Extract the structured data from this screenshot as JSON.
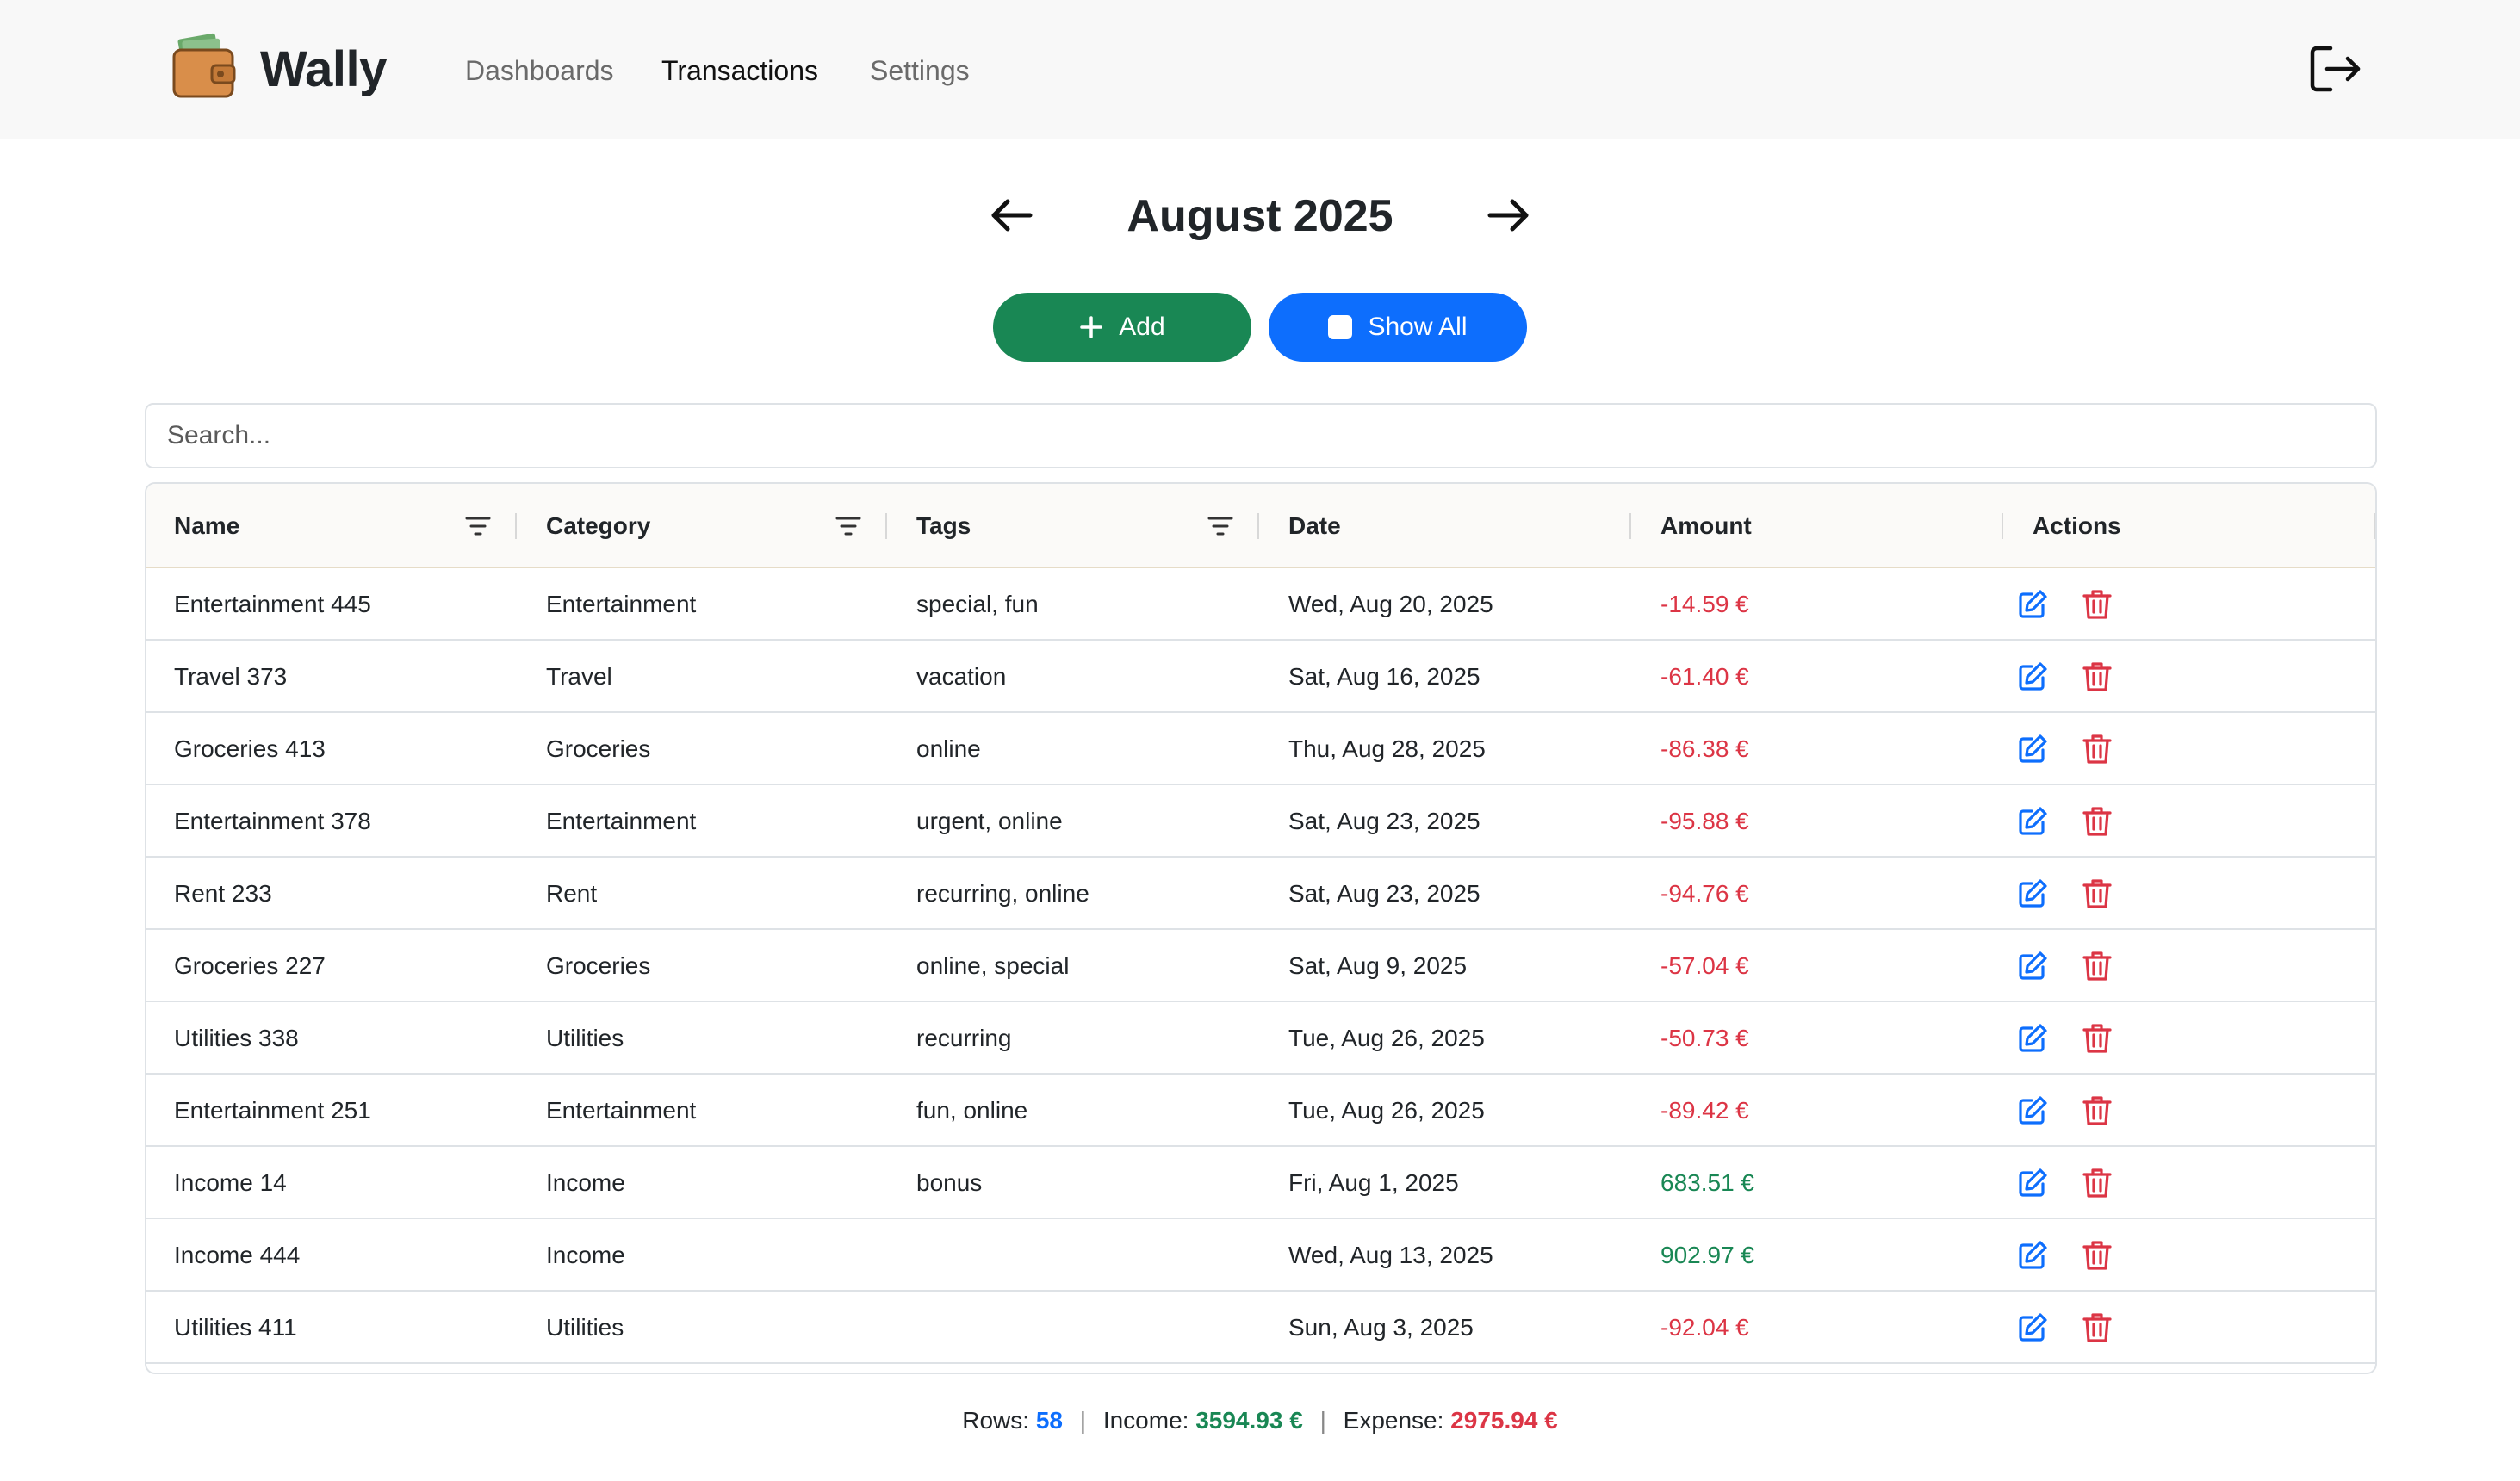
{
  "app": {
    "brand": "Wally"
  },
  "nav": {
    "links": [
      {
        "label": "Dashboards",
        "active": false
      },
      {
        "label": "Transactions",
        "active": true
      },
      {
        "label": "Settings",
        "active": false
      }
    ]
  },
  "period": {
    "title": "August 2025"
  },
  "actions": {
    "add_label": "Add",
    "show_all_label": "Show All"
  },
  "search": {
    "placeholder": "Search...",
    "value": ""
  },
  "table": {
    "columns": [
      "Name",
      "Category",
      "Tags",
      "Date",
      "Amount",
      "Actions"
    ],
    "rows": [
      {
        "name": "Entertainment 445",
        "category": "Entertainment",
        "tags": "special, fun",
        "date": "Wed, Aug 20, 2025",
        "amount": "-14.59 €",
        "type": "expense"
      },
      {
        "name": "Travel 373",
        "category": "Travel",
        "tags": "vacation",
        "date": "Sat, Aug 16, 2025",
        "amount": "-61.40 €",
        "type": "expense"
      },
      {
        "name": "Groceries 413",
        "category": "Groceries",
        "tags": "online",
        "date": "Thu, Aug 28, 2025",
        "amount": "-86.38 €",
        "type": "expense"
      },
      {
        "name": "Entertainment 378",
        "category": "Entertainment",
        "tags": "urgent, online",
        "date": "Sat, Aug 23, 2025",
        "amount": "-95.88 €",
        "type": "expense"
      },
      {
        "name": "Rent 233",
        "category": "Rent",
        "tags": "recurring, online",
        "date": "Sat, Aug 23, 2025",
        "amount": "-94.76 €",
        "type": "expense"
      },
      {
        "name": "Groceries 227",
        "category": "Groceries",
        "tags": "online, special",
        "date": "Sat, Aug 9, 2025",
        "amount": "-57.04 €",
        "type": "expense"
      },
      {
        "name": "Utilities 338",
        "category": "Utilities",
        "tags": "recurring",
        "date": "Tue, Aug 26, 2025",
        "amount": "-50.73 €",
        "type": "expense"
      },
      {
        "name": "Entertainment 251",
        "category": "Entertainment",
        "tags": "fun, online",
        "date": "Tue, Aug 26, 2025",
        "amount": "-89.42 €",
        "type": "expense"
      },
      {
        "name": "Income 14",
        "category": "Income",
        "tags": "bonus",
        "date": "Fri, Aug 1, 2025",
        "amount": "683.51 €",
        "type": "income"
      },
      {
        "name": "Income 444",
        "category": "Income",
        "tags": "",
        "date": "Wed, Aug 13, 2025",
        "amount": "902.97 €",
        "type": "income"
      },
      {
        "name": "Utilities 411",
        "category": "Utilities",
        "tags": "",
        "date": "Sun, Aug 3, 2025",
        "amount": "-92.04 €",
        "type": "expense"
      }
    ]
  },
  "summary": {
    "rows_label": "Rows:",
    "rows_value": "58",
    "income_label": "Income:",
    "income_value": "3594.93 €",
    "expense_label": "Expense:",
    "expense_value": "2975.94 €"
  },
  "colors": {
    "add_button": "#198754",
    "show_all_button": "#0d6efd",
    "expense": "#dc3545",
    "income": "#198754",
    "edit_icon": "#0d6efd",
    "delete_icon": "#dc3545"
  },
  "icons": {
    "logo": "wallet-icon",
    "logout": "logout-icon",
    "prev": "arrow-left-icon",
    "next": "arrow-right-icon",
    "add": "plus-icon",
    "filter": "filter-icon",
    "edit": "edit-icon",
    "delete": "trash-icon"
  }
}
